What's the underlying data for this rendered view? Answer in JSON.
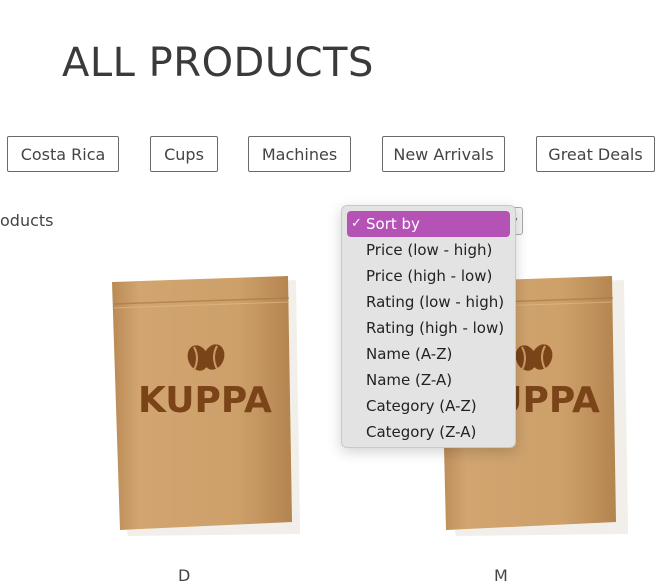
{
  "page": {
    "title": "ALL PRODUCTS"
  },
  "filters": [
    "Costa Rica",
    "Cups",
    "Machines",
    "New Arrivals",
    "Great Deals"
  ],
  "results": {
    "count_text_fragment": "oducts"
  },
  "sort": {
    "selected_index": 0,
    "checkmark": "✓",
    "options": [
      "Sort by",
      "Price (low - high)",
      "Price (high - low)",
      "Rating (low - high)",
      "Rating (high - low)",
      "Name (A-Z)",
      "Name (Z-A)",
      "Category (A-Z)",
      "Category (Z-A)"
    ]
  },
  "products": [
    {
      "brand": "KUPPA",
      "icon": "coffee-beans-icon"
    },
    {
      "brand": "KUPPA",
      "icon": "coffee-beans-icon"
    }
  ],
  "colors": {
    "bag": "#c99a64",
    "bag_text": "#7a4418",
    "dropdown_highlight": "#b552b5"
  }
}
